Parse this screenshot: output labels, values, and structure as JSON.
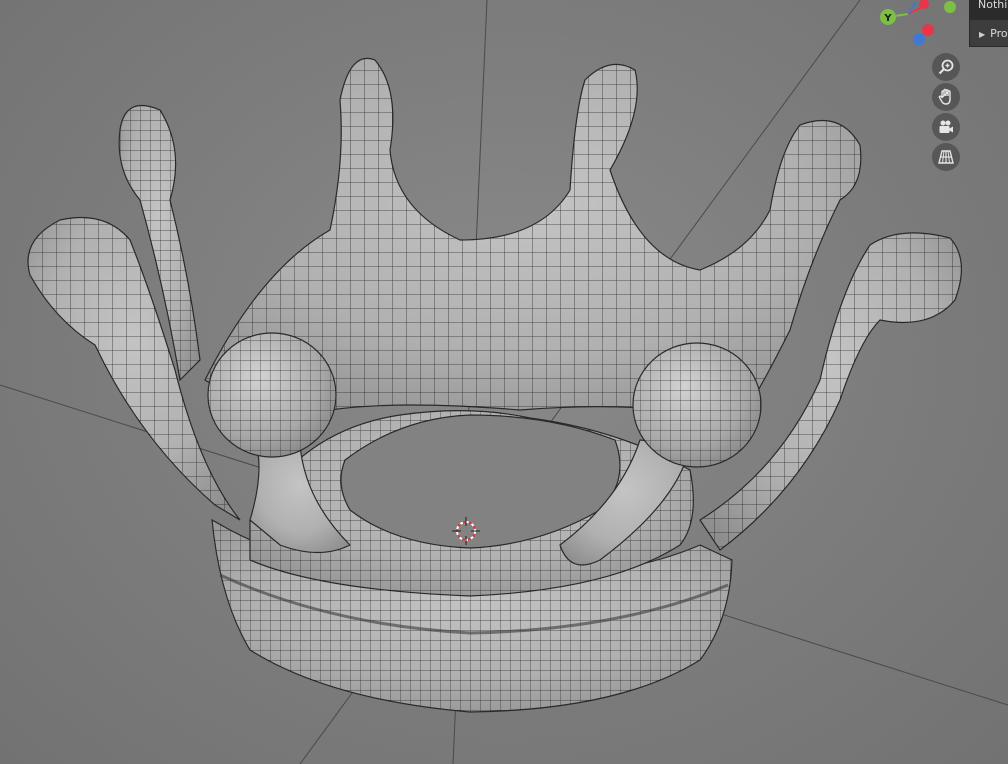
{
  "viewport": {
    "object": "crown-mesh",
    "shading": "wireframe-overlay"
  },
  "gizmo": {
    "y_label": "Y",
    "colors": {
      "x": "#e8354a",
      "y": "#7cc043",
      "z": "#3f78d6"
    }
  },
  "nav_buttons": [
    {
      "name": "zoom-icon",
      "tooltip": "zoom"
    },
    {
      "name": "pan-hand-icon",
      "tooltip": "pan"
    },
    {
      "name": "camera-icon",
      "tooltip": "camera"
    },
    {
      "name": "grid-perspective-icon",
      "tooltip": "perspective"
    }
  ],
  "side_panel": {
    "row1_text": "Nothin",
    "row2_text": "Pro"
  },
  "colors": {
    "background": "#7d7d7d",
    "mesh": "#b5b5b5",
    "wire": "#1e1e1e"
  }
}
